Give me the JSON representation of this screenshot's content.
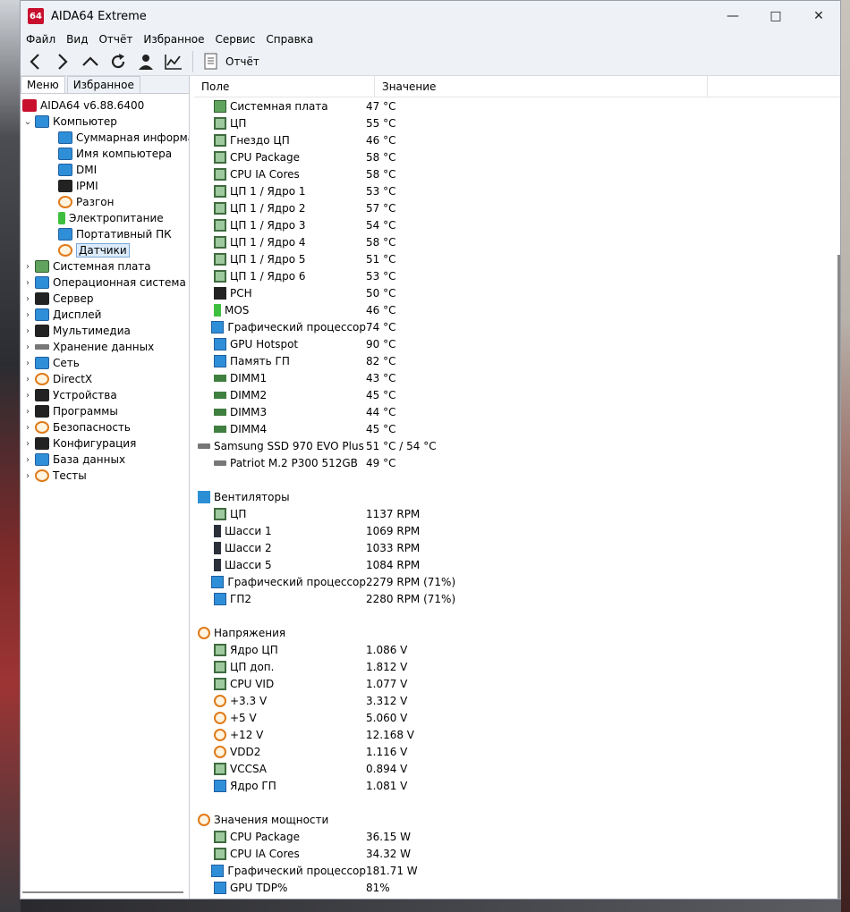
{
  "window": {
    "title": "AIDA64 Extreme",
    "logo": "64"
  },
  "menu": [
    "Файл",
    "Вид",
    "Отчёт",
    "Избранное",
    "Сервис",
    "Справка"
  ],
  "toolbar": {
    "report_label": "Отчёт"
  },
  "tabs": [
    "Меню",
    "Избранное"
  ],
  "tree": {
    "root": "AIDA64 v6.88.6400",
    "computer": "Компьютер",
    "computer_children": [
      "Суммарная информация",
      "Имя компьютера",
      "DMI",
      "IPMI",
      "Разгон",
      "Электропитание",
      "Портативный ПК",
      "Датчики"
    ],
    "top_items": [
      "Системная плата",
      "Операционная система",
      "Сервер",
      "Дисплей",
      "Мультимедиа",
      "Хранение данных",
      "Сеть",
      "DirectX",
      "Устройства",
      "Программы",
      "Безопасность",
      "Конфигурация",
      "База данных",
      "Тесты"
    ]
  },
  "columns": {
    "field": "Поле",
    "value": "Значение"
  },
  "temps": [
    {
      "f": "Системная плата",
      "v": "47 °C",
      "icon": "board"
    },
    {
      "f": "ЦП",
      "v": "55 °C",
      "icon": "chip"
    },
    {
      "f": "Гнездо ЦП",
      "v": "46 °C",
      "icon": "chip"
    },
    {
      "f": "CPU Package",
      "v": "58 °C",
      "icon": "chip"
    },
    {
      "f": "CPU IA Cores",
      "v": "58 °C",
      "icon": "chip"
    },
    {
      "f": "ЦП 1 / Ядро 1",
      "v": "53 °C",
      "icon": "chip"
    },
    {
      "f": "ЦП 1 / Ядро 2",
      "v": "57 °C",
      "icon": "chip"
    },
    {
      "f": "ЦП 1 / Ядро 3",
      "v": "54 °C",
      "icon": "chip"
    },
    {
      "f": "ЦП 1 / Ядро 4",
      "v": "58 °C",
      "icon": "chip"
    },
    {
      "f": "ЦП 1 / Ядро 5",
      "v": "51 °C",
      "icon": "chip"
    },
    {
      "f": "ЦП 1 / Ядро 6",
      "v": "53 °C",
      "icon": "chip"
    },
    {
      "f": "PCH",
      "v": "50 °C",
      "icon": "pch"
    },
    {
      "f": "MOS",
      "v": "46 °C",
      "icon": "mos"
    },
    {
      "f": "Графический процессор",
      "v": "74 °C",
      "icon": "mon"
    },
    {
      "f": "GPU Hotspot",
      "v": "90 °C",
      "icon": "mon"
    },
    {
      "f": "Память ГП",
      "v": "82 °C",
      "icon": "mon"
    },
    {
      "f": "DIMM1",
      "v": "43 °C",
      "icon": "dimm"
    },
    {
      "f": "DIMM2",
      "v": "45 °C",
      "icon": "dimm"
    },
    {
      "f": "DIMM3",
      "v": "44 °C",
      "icon": "dimm"
    },
    {
      "f": "DIMM4",
      "v": "45 °C",
      "icon": "dimm"
    },
    {
      "f": "Samsung SSD 970 EVO Plus ...",
      "v": "51 °C / 54 °C",
      "icon": "ssd"
    },
    {
      "f": "Patriot M.2 P300 512GB",
      "v": "49 °C",
      "icon": "ssd"
    }
  ],
  "fans_title": "Вентиляторы",
  "fans": [
    {
      "f": "ЦП",
      "v": "1137 RPM",
      "icon": "chip"
    },
    {
      "f": "Шасси 1",
      "v": "1069 RPM",
      "icon": "fanbox"
    },
    {
      "f": "Шасси 2",
      "v": "1033 RPM",
      "icon": "fanbox"
    },
    {
      "f": "Шасси 5",
      "v": "1084 RPM",
      "icon": "fanbox"
    },
    {
      "f": "Графический процессор",
      "v": "2279 RPM  (71%)",
      "icon": "mon"
    },
    {
      "f": "ГП2",
      "v": "2280 RPM  (71%)",
      "icon": "mon"
    }
  ],
  "volts_title": "Напряжения",
  "volts": [
    {
      "f": "Ядро ЦП",
      "v": "1.086 V",
      "icon": "chip"
    },
    {
      "f": "ЦП доп.",
      "v": "1.812 V",
      "icon": "chip"
    },
    {
      "f": "CPU VID",
      "v": "1.077 V",
      "icon": "chip"
    },
    {
      "f": "+3.3 V",
      "v": "3.312 V",
      "icon": "bolt"
    },
    {
      "f": "+5 V",
      "v": "5.060 V",
      "icon": "bolt"
    },
    {
      "f": "+12 V",
      "v": "12.168 V",
      "icon": "bolt"
    },
    {
      "f": "VDD2",
      "v": "1.116 V",
      "icon": "bolt"
    },
    {
      "f": "VCCSA",
      "v": "0.894 V",
      "icon": "chip"
    },
    {
      "f": "Ядро ГП",
      "v": "1.081 V",
      "icon": "mon"
    }
  ],
  "power_title": "Значения мощности",
  "power": [
    {
      "f": "CPU Package",
      "v": "36.15 W",
      "icon": "chip"
    },
    {
      "f": "CPU IA Cores",
      "v": "34.32 W",
      "icon": "chip"
    },
    {
      "f": "Графический процессор",
      "v": "181.71 W",
      "icon": "mon"
    },
    {
      "f": "GPU TDP%",
      "v": "81%",
      "icon": "mon"
    }
  ]
}
